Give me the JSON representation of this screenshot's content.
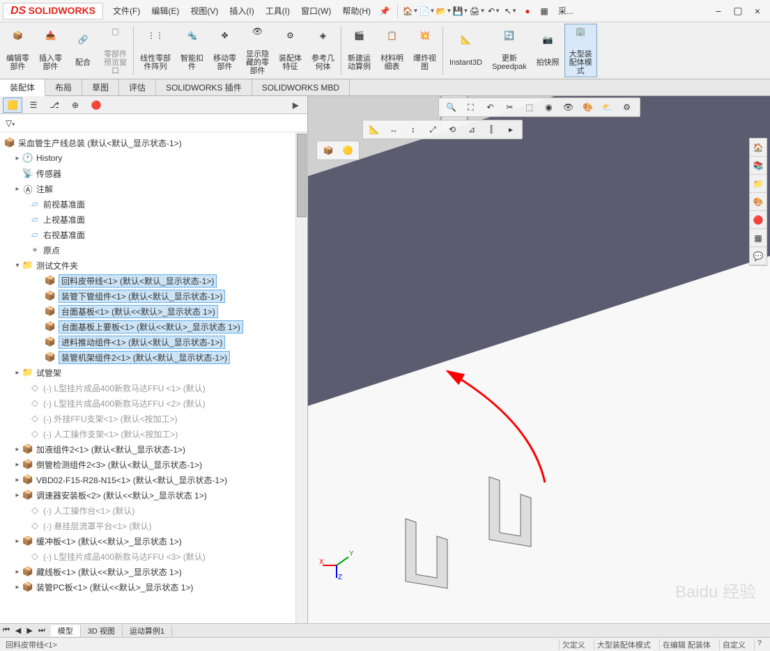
{
  "app": {
    "logo_prefix": "DS",
    "logo_text": "SOLIDWORKS"
  },
  "menu": {
    "file": "文件(F)",
    "edit": "编辑(E)",
    "view": "视图(V)",
    "insert": "插入(I)",
    "tools": "工具(I)",
    "window": "窗口(W)",
    "help": "帮助(H)",
    "extra": "采..."
  },
  "ribbon": {
    "edit_part": "编辑零\n部件",
    "insert_part": "插入零\n部件",
    "mate": "配合",
    "preview": "零部件\n预览窗\n口",
    "linear": "线性零部\n件阵列",
    "smart": "智能扣\n件",
    "move": "移动零\n部件",
    "showhide": "显示隐\n藏的零\n部件",
    "asm_feat": "装配体\n特征",
    "ref_geom": "参考几\n何体",
    "motion": "新建运\n动算例",
    "bom": "材料明\n细表",
    "exploded": "爆炸视\n图",
    "instant3d": "Instant3D",
    "speedpak": "更新\nSpeedpak",
    "snapshot": "拍快照",
    "large": "大型装\n配体模\n式"
  },
  "tabs": {
    "assembly": "装配体",
    "layout": "布局",
    "sketch": "草图",
    "evaluate": "评估",
    "plugins": "SOLIDWORKS 插件",
    "mbd": "SOLIDWORKS MBD"
  },
  "tree": {
    "root": "采血管生产线总装  (默认<默认_显示状态-1>)",
    "history": "History",
    "sensors": "传感器",
    "annotations": "注解",
    "front": "前视基准面",
    "top": "上视基准面",
    "right": "右视基准面",
    "origin": "原点",
    "test_folder": "测试文件夹",
    "selected": [
      "回料皮带线<1>  (默认<默认_显示状态-1>)",
      "装管下管组件<1>  (默认<默认_显示状态-1>)",
      "台面基板<1>  (默认<<默认>_显示状态 1>)",
      "台面基板上要板<1>  (默认<<默认>_显示状态 1>)",
      "进料推动组件<1>  (默认<默认_显示状态-1>)",
      "装管机架组件2<1>  (默认<默认_显示状态-1>)"
    ],
    "tube_rack": "试管架",
    "grayed1": "(-) L型挂片成品400新款马达FFU <1>  (默认)",
    "grayed2": "(-) L型挂片成品400新款马达FFU <2>  (默认)",
    "grayed3": "(-) 外挂FFU支架<1>  (默认<按加工>)",
    "grayed4": "(-) 人工操作支架<1>  (默认<按加工>)",
    "item5": "加液组件2<1>  (默认<默认_显示状态-1>)",
    "item6": "倒管检测组件2<3>  (默认<默认_显示状态-1>)",
    "item7": "VBD02-F15-R28-N15<1>  (默认<默认_显示状态-1>)",
    "item8": "调速器安装板<2>  (默认<<默认>_显示状态 1>)",
    "grayed5": "(-) 人工操作台<1>  (默认)",
    "grayed6": "(-) 悬挂层流罩平台<1>  (默认)",
    "item9": "缓冲板<1>  (默认<<默认>_显示状态 1>)",
    "grayed7": "(-) L型挂片成品400新款马达FFU <3>  (默认)",
    "item10": "藏线板<1>  (默认<<默认>_显示状态 1>)",
    "item11": "装管PC板<1>  (默认<<默认>_显示状态 1>)"
  },
  "triad": {
    "x": "X",
    "y": "Y",
    "z": "Z"
  },
  "bottom_tabs": {
    "model": "模型",
    "view3d": "3D 视图",
    "motion1": "运动算例1"
  },
  "status": {
    "left": "回料皮带线<1>",
    "underdefined": "欠定义",
    "large_mode": "大型装配体模式",
    "editing": "在编辑 配装体",
    "custom": "自定义"
  },
  "watermark": "Baidu 经验"
}
